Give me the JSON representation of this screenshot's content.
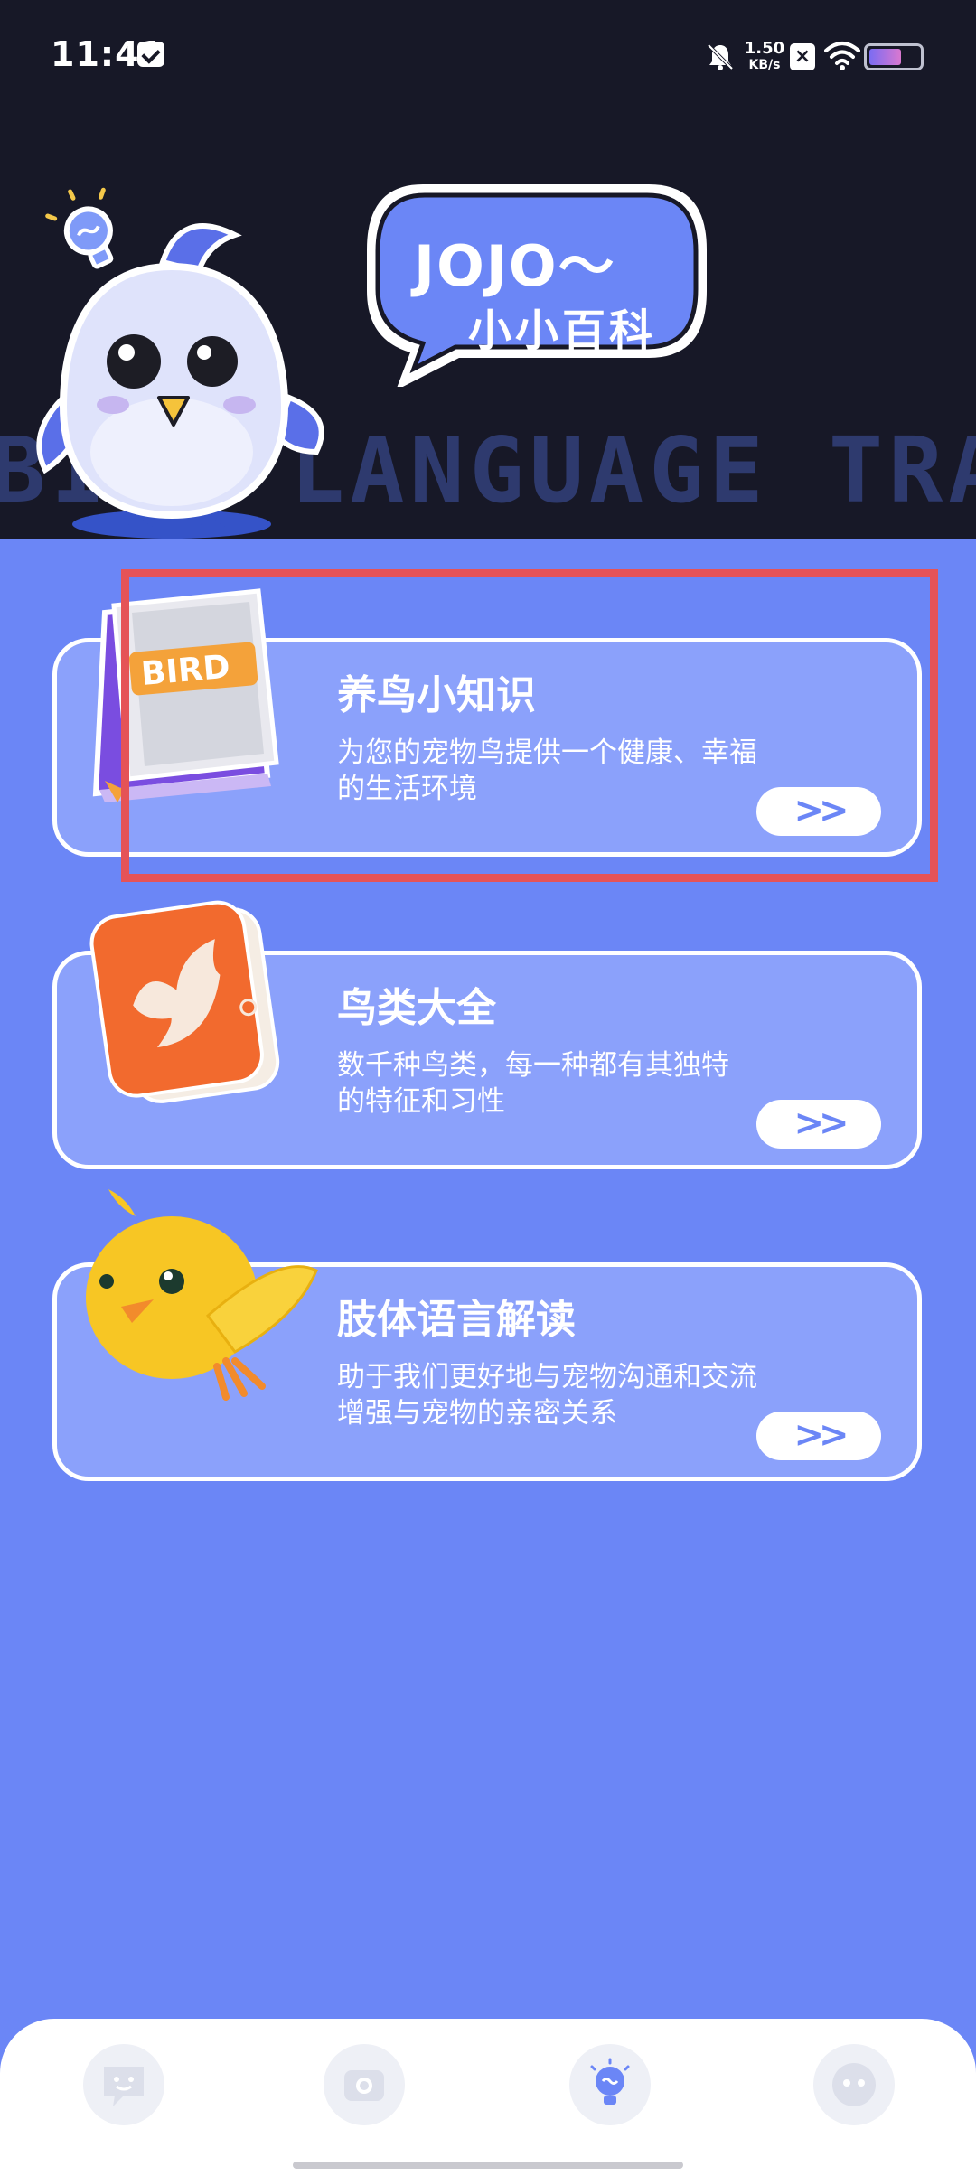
{
  "status_bar": {
    "time": "11:41",
    "net_speed_value": "1.50",
    "net_speed_unit": "KB/s",
    "battery_level": 0.65
  },
  "header": {
    "background_text": "BIRD LANGUAGE TRANSL",
    "bubble_title": "JOJO～",
    "bubble_subtitle": "小小百科"
  },
  "cards": [
    {
      "title": "养鸟小知识",
      "desc_line1": "为您的宠物鸟提供一个健康、幸福",
      "desc_line2": "的生活环境",
      "arrow": ">>",
      "book_label": "BIRD"
    },
    {
      "title": "鸟类大全",
      "desc_line1": "数千种鸟类，每一种都有其独特",
      "desc_line2": "的特征和习性",
      "arrow": ">>"
    },
    {
      "title": "肢体语言解读",
      "desc_line1": "助于我们更好地与宠物沟通和交流",
      "desc_line2": "增强与宠物的亲密关系",
      "arrow": ">>"
    }
  ],
  "tabbar": {
    "tabs": [
      "chat-icon",
      "camera-icon",
      "bulb-icon",
      "face-icon"
    ],
    "active_index": 2
  },
  "colors": {
    "header_bg": "#171827",
    "page_bg": "#6b86f6",
    "card_bg": "#8ba1fb",
    "highlight": "#e55357"
  }
}
